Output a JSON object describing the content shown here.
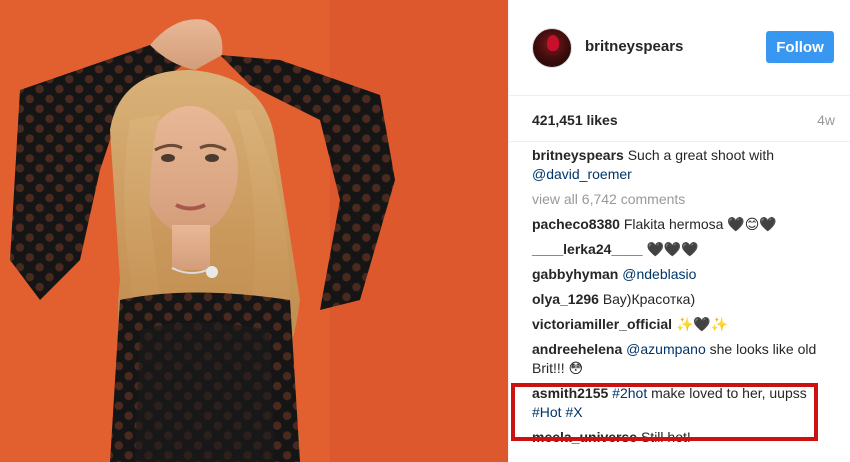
{
  "post": {
    "username": "britneyspears",
    "follow_label": "Follow",
    "likes": "421,451 likes",
    "age": "4w"
  },
  "caption": {
    "user": "britneyspears",
    "text": " Such a great shoot with ",
    "mention": "@david_roemer"
  },
  "view_all": "view all 6,742 comments",
  "comments": [
    {
      "user": "pacheco8380",
      "parts": [
        {
          "t": " Flakita hermosa 🖤😊🖤",
          "link": false
        }
      ]
    },
    {
      "user": "____lerka24____",
      "parts": [
        {
          "t": " 🖤🖤🖤",
          "link": false
        }
      ]
    },
    {
      "user": "gabbyhyman",
      "parts": [
        {
          "t": " ",
          "link": false
        },
        {
          "t": "@ndeblasio",
          "link": true
        }
      ]
    },
    {
      "user": "olya_1296",
      "parts": [
        {
          "t": " Вау)Красотка)",
          "link": false
        }
      ]
    },
    {
      "user": "victoriamiller_official",
      "parts": [
        {
          "t": " ✨🖤✨",
          "link": false
        }
      ]
    },
    {
      "user": "andreehelena",
      "parts": [
        {
          "t": " ",
          "link": false
        },
        {
          "t": "@azumpano",
          "link": true
        },
        {
          "t": " she looks like old Brit!!! 😳",
          "link": false
        }
      ]
    },
    {
      "user": "asmith2155",
      "parts": [
        {
          "t": " ",
          "link": false
        },
        {
          "t": "#2hot",
          "link": true
        },
        {
          "t": " make loved to her, uupss ",
          "link": false
        },
        {
          "t": "#Hot",
          "link": true
        },
        {
          "t": " ",
          "link": false
        },
        {
          "t": "#X",
          "link": true
        }
      ]
    },
    {
      "user": "meela_universe",
      "parts": [
        {
          "t": " Still hot!",
          "link": false
        }
      ]
    }
  ],
  "colors": {
    "follow_bg": "#3897f0",
    "link": "#003569",
    "highlight_border": "#cc1111",
    "photo_bg": "#e25a2c"
  }
}
